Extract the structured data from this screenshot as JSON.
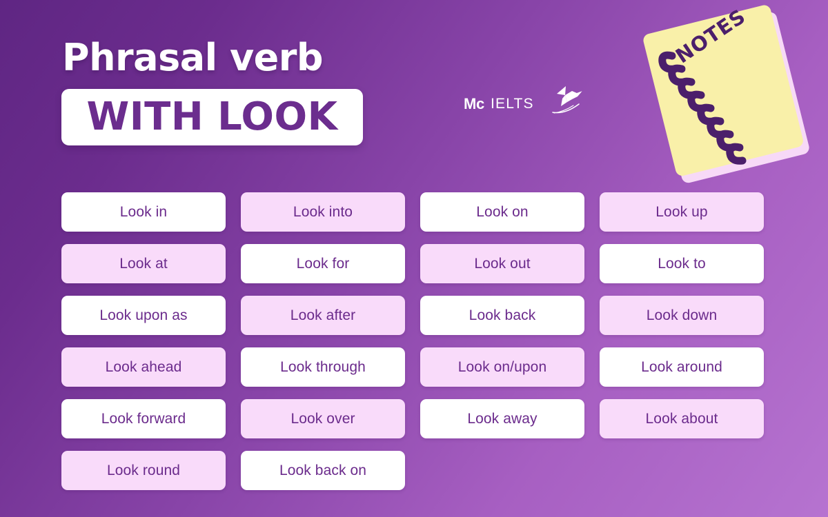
{
  "header": {
    "title_line_1": "Phrasal verb",
    "title_line_2": "WITH LOOK"
  },
  "logo": {
    "mc": "Mc",
    "ielts": "IELTS",
    "bird_icon": "hummingbird-icon"
  },
  "notebook": {
    "label": "NOTES",
    "cover_color": "#f9f0a9",
    "page_color": "#f7d9f7",
    "spiral_color": "#4b1f6b",
    "text_color": "#4b1f6b"
  },
  "theme": {
    "bg_dark": "#5f2683",
    "bg_light": "#b673d0",
    "card_white": "#ffffff",
    "card_pink": "#f9dbfa",
    "card_text": "#6b2b8c",
    "title_box_bg": "#ffffff",
    "title_box_text": "#6b2d8e"
  },
  "grid": {
    "columns": 4,
    "rows": 6,
    "cards": [
      {
        "label": "Look in",
        "style": "white"
      },
      {
        "label": "Look into",
        "style": "pink"
      },
      {
        "label": "Look on",
        "style": "white"
      },
      {
        "label": "Look up",
        "style": "pink"
      },
      {
        "label": "Look at",
        "style": "pink"
      },
      {
        "label": "Look for",
        "style": "white"
      },
      {
        "label": "Look out",
        "style": "pink"
      },
      {
        "label": "Look to",
        "style": "white"
      },
      {
        "label": "Look upon as",
        "style": "white"
      },
      {
        "label": "Look after",
        "style": "pink"
      },
      {
        "label": "Look back",
        "style": "white"
      },
      {
        "label": "Look down",
        "style": "pink"
      },
      {
        "label": "Look ahead",
        "style": "pink"
      },
      {
        "label": "Look through",
        "style": "white"
      },
      {
        "label": "Look on/upon",
        "style": "pink"
      },
      {
        "label": "Look around",
        "style": "white"
      },
      {
        "label": "Look forward",
        "style": "white"
      },
      {
        "label": "Look over",
        "style": "pink"
      },
      {
        "label": "Look away",
        "style": "white"
      },
      {
        "label": "Look about",
        "style": "pink"
      },
      {
        "label": "Look round",
        "style": "pink"
      },
      {
        "label": "Look back on",
        "style": "white"
      },
      {
        "label": "",
        "style": "empty"
      },
      {
        "label": "",
        "style": "empty"
      }
    ]
  }
}
